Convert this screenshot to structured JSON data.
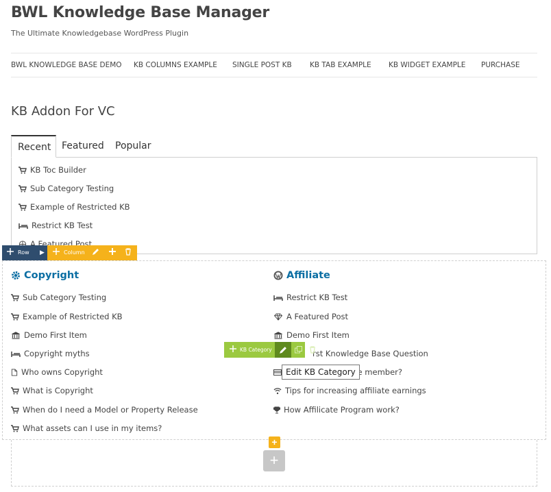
{
  "site": {
    "title": "BWL Knowledge Base Manager",
    "tagline": "The Ultimate Knowledgebase WordPress Plugin"
  },
  "nav": {
    "items": [
      "BWL KNOWLEDGE BASE DEMO",
      "KB COLUMNS EXAMPLE",
      "SINGLE POST KB",
      "KB TAB EXAMPLE",
      "KB WIDGET EXAMPLE",
      "PURCHASE"
    ]
  },
  "page": {
    "title": "KB Addon For VC"
  },
  "tabs": {
    "labels": [
      "Recent",
      "Featured",
      "Popular"
    ],
    "active": "Recent",
    "recent_items": [
      {
        "label": "KB Toc Builder",
        "icon": "cart-icon"
      },
      {
        "label": "Sub Category Testing",
        "icon": "cart-icon"
      },
      {
        "label": "Example of Restricted KB",
        "icon": "cart-icon"
      },
      {
        "label": "Restrict KB Test",
        "icon": "bed-icon"
      },
      {
        "label": "A Featured Post",
        "icon": "globe-icon"
      }
    ]
  },
  "vc": {
    "row_label": "Row",
    "column_label": "Column",
    "kb_category_label": "KB Category",
    "tooltip": "Edit KB Category",
    "colors": {
      "row": "#2f4d6e",
      "column": "#f5b21b",
      "element": "#9bc940"
    }
  },
  "columns": {
    "left": {
      "heading": "Copyright",
      "items": [
        {
          "label": "Sub Category Testing",
          "icon": "cart-icon"
        },
        {
          "label": "Example of Restricted KB",
          "icon": "cart-icon"
        },
        {
          "label": "Demo First Item",
          "icon": "bank-icon"
        },
        {
          "label": "Copyright myths",
          "icon": "bed-icon"
        },
        {
          "label": "Who owns Copyright",
          "icon": "file-icon"
        },
        {
          "label": "What is Copyright",
          "icon": "cart-icon"
        },
        {
          "label": "When do I need a Model or Property Release",
          "icon": "cart-icon"
        },
        {
          "label": "What assets can I use in my items?",
          "icon": "cart-icon"
        }
      ]
    },
    "right": {
      "heading": "Affiliate",
      "items": [
        {
          "label": "Restrict KB Test",
          "icon": "bed-icon"
        },
        {
          "label": "A Featured Post",
          "icon": "diamond-icon"
        },
        {
          "label": "Demo First Item",
          "icon": "bank-icon"
        },
        {
          "label": "rst Knowledge Base Question",
          "icon": "question-icon"
        },
        {
          "label": "ate member?",
          "icon": "card-icon"
        },
        {
          "label": "Tips for increasing affiliate earnings",
          "icon": "wifi-icon"
        },
        {
          "label": "How Affilicate Program work?",
          "icon": "trophy-icon"
        }
      ]
    }
  },
  "accent": "#0b6ea3"
}
